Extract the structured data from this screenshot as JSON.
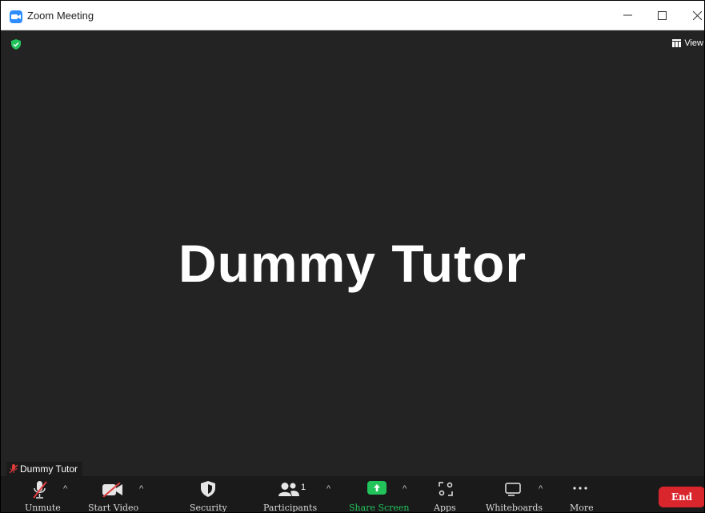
{
  "window": {
    "title": "Zoom Meeting",
    "controls": {
      "minimize": "—",
      "maximize": "☐",
      "close": "✕"
    }
  },
  "meeting": {
    "view_label": "View",
    "participant_display_name": "Dummy Tutor",
    "name_tag": "Dummy Tutor",
    "security_icon_color": "#22c35b"
  },
  "toolbar": {
    "unmute_label": "Unmute",
    "start_video_label": "Start Video",
    "security_label": "Security",
    "participants_label": "Participants",
    "participants_count": "1",
    "share_screen_label": "Share Screen",
    "apps_label": "Apps",
    "whiteboards_label": "Whiteboards",
    "more_label": "More",
    "end_label": "End",
    "share_color": "#22c35b",
    "end_color": "#d9252c"
  }
}
